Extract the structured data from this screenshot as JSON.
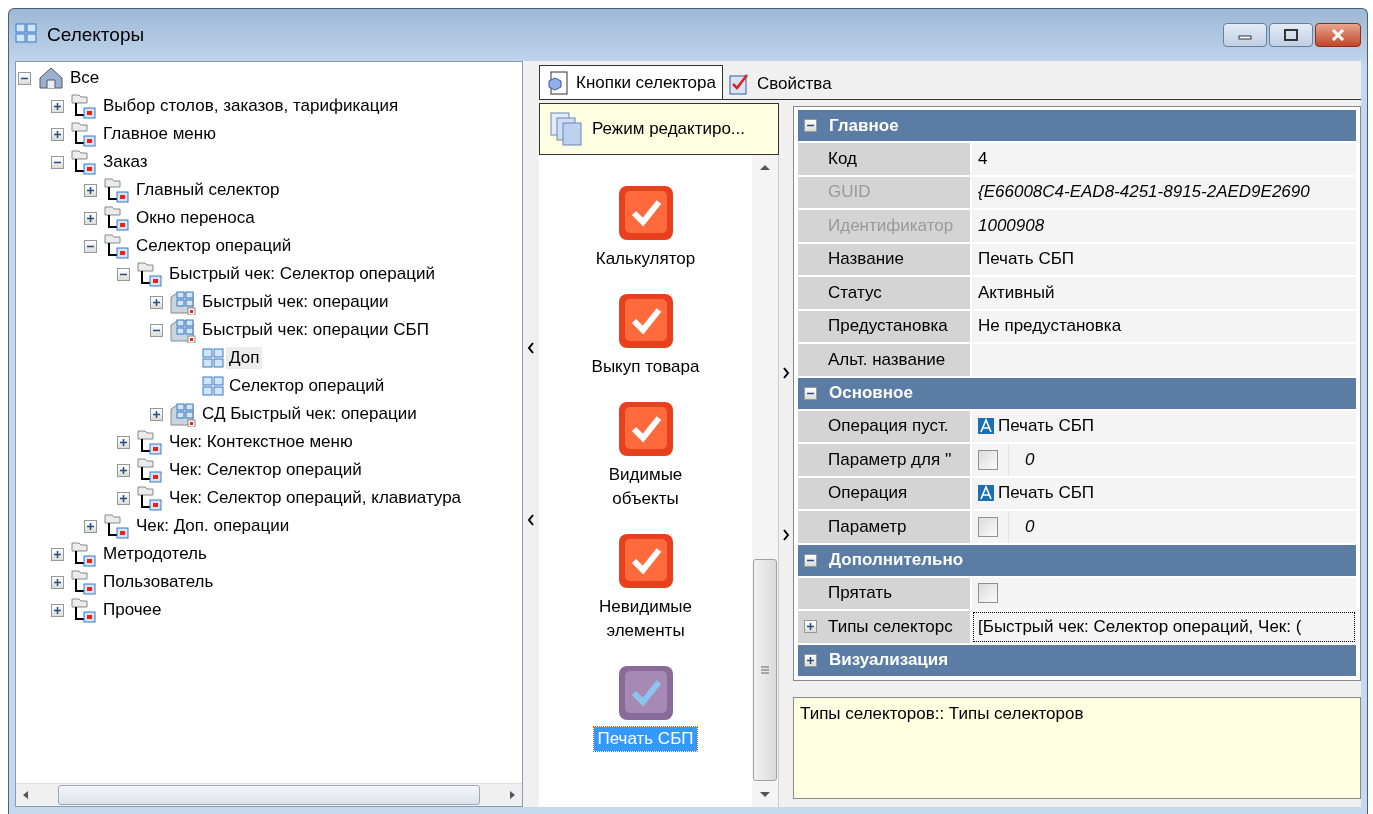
{
  "window": {
    "title": "Селекторы"
  },
  "tree": [
    {
      "label": "Все",
      "kind": "root",
      "expanded": true,
      "selected": false,
      "children": [
        {
          "label": "Выбор столов, заказов, тарификация",
          "kind": "folder",
          "expanded": false,
          "selected": false
        },
        {
          "label": "Главное меню",
          "kind": "folder",
          "expanded": false,
          "selected": false
        },
        {
          "label": "Заказ",
          "kind": "folder",
          "expanded": true,
          "selected": false,
          "children": [
            {
              "label": "Главный селектор",
              "kind": "folder",
              "expanded": false,
              "selected": false
            },
            {
              "label": "Окно переноса",
              "kind": "folder",
              "expanded": false,
              "selected": false
            },
            {
              "label": "Селектор операций",
              "kind": "folder",
              "expanded": true,
              "selected": false,
              "children": [
                {
                  "label": "Быстрый чек: Селектор операций",
                  "kind": "folder",
                  "expanded": true,
                  "selected": false,
                  "children": [
                    {
                      "label": "Быстрый чек: операции",
                      "kind": "group",
                      "expanded": false,
                      "selected": false
                    },
                    {
                      "label": "Быстрый чек: операции СБП",
                      "kind": "group",
                      "expanded": true,
                      "selected": false,
                      "children": [
                        {
                          "label": "Доп",
                          "kind": "selector",
                          "selected": true
                        },
                        {
                          "label": "Селектор операций",
                          "kind": "selector",
                          "selected": false
                        }
                      ]
                    },
                    {
                      "label": "СД Быстрый чек: операции",
                      "kind": "group",
                      "expanded": false,
                      "selected": false
                    }
                  ]
                },
                {
                  "label": "Чек: Контекстное меню",
                  "kind": "folder",
                  "expanded": false,
                  "selected": false
                },
                {
                  "label": "Чек: Селектор операций",
                  "kind": "folder",
                  "expanded": false,
                  "selected": false
                },
                {
                  "label": "Чек: Селектор операций, клавиатура",
                  "kind": "folder",
                  "expanded": false,
                  "selected": false
                }
              ]
            },
            {
              "label": "Чек: Доп. операции",
              "kind": "folder",
              "expanded": false,
              "selected": false
            }
          ]
        },
        {
          "label": "Метродотель",
          "kind": "folder",
          "expanded": false,
          "selected": false
        },
        {
          "label": "Пользователь",
          "kind": "folder",
          "expanded": false,
          "selected": false
        },
        {
          "label": "Прочее",
          "kind": "folder",
          "expanded": false,
          "selected": false
        }
      ]
    }
  ],
  "tabs": [
    {
      "label": "Кнопки селектора",
      "kind": "buttons",
      "selected": true
    },
    {
      "label": "Свойства",
      "kind": "properties",
      "selected": false
    }
  ],
  "edit_mode_button": {
    "label": "Режим редактиро..."
  },
  "selector_buttons": [
    {
      "label": "Калькулятор",
      "selected": false
    },
    {
      "label": "Выкуп товара",
      "selected": false
    },
    {
      "label": "Видимые объекты",
      "selected": false
    },
    {
      "label": "Невидимые элементы",
      "selected": false
    },
    {
      "label": "Печать СБП",
      "selected": true
    }
  ],
  "property_groups": [
    {
      "title": "Главное",
      "expanded": true,
      "rows": [
        {
          "label": "Код",
          "kind": "text",
          "value": "4",
          "disabled": false,
          "selected": false
        },
        {
          "label": "GUID",
          "kind": "text",
          "value": "{E66008C4-EAD8-4251-8915-2AED9E2690",
          "disabled": true,
          "selected": false
        },
        {
          "label": "Идентификатор",
          "kind": "text",
          "value": "1000908",
          "disabled": true,
          "selected": false
        },
        {
          "label": "Название",
          "kind": "text",
          "value": "Печать СБП",
          "disabled": false,
          "selected": false
        },
        {
          "label": "Статус",
          "kind": "text",
          "value": "Активный",
          "disabled": false,
          "selected": false
        },
        {
          "label": "Предустановка",
          "kind": "text",
          "value": "Не предустановка",
          "disabled": false,
          "selected": false
        },
        {
          "label": "Альт. название",
          "kind": "empty",
          "disabled": false,
          "selected": false
        }
      ]
    },
    {
      "title": "Основное",
      "expanded": true,
      "rows": [
        {
          "label": "Операция пуст.",
          "kind": "operation",
          "value": "Печать СБП",
          "disabled": false,
          "selected": false
        },
        {
          "label": "Параметр для ''",
          "kind": "checkbox",
          "checked": false,
          "value": "0",
          "disabled": false,
          "selected": false
        },
        {
          "label": "Операция",
          "kind": "operation",
          "value": "Печать СБП",
          "disabled": false,
          "selected": false
        },
        {
          "label": "Параметр",
          "kind": "checkbox",
          "checked": false,
          "value": "0",
          "disabled": false,
          "selected": false
        }
      ]
    },
    {
      "title": "Дополнительно",
      "expanded": true,
      "rows": [
        {
          "label": "Прятать",
          "kind": "checkbox",
          "checked": false,
          "disabled": false,
          "selected": false
        },
        {
          "label": "Типы селекторс",
          "kind": "list",
          "expanded": false,
          "value": "[Быстрый чек: Селектор операций, Чек: (",
          "disabled": false,
          "selected": true
        }
      ]
    },
    {
      "title": "Визуализация",
      "expanded": false
    }
  ],
  "description": {
    "text": "Типы селекторов:: Типы селекторов"
  }
}
